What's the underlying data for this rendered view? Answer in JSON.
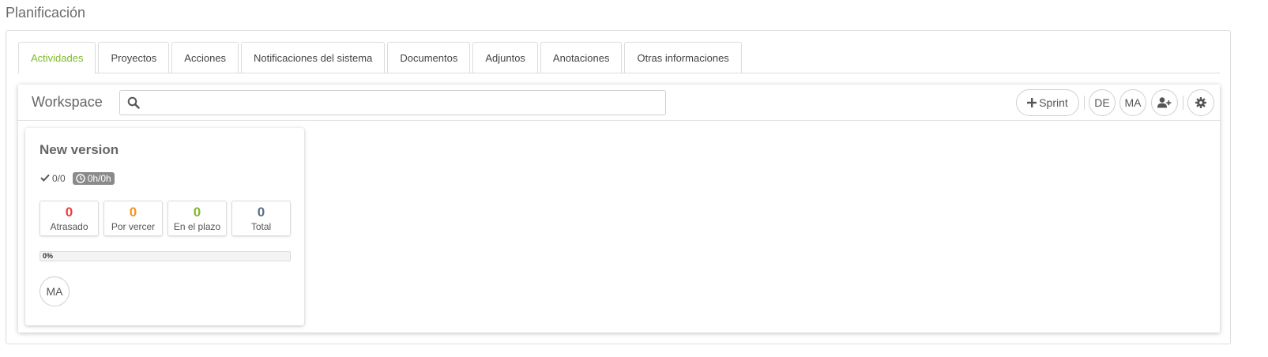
{
  "page_title": "Planificación",
  "tabs": [
    {
      "label": "Actividades",
      "active": true
    },
    {
      "label": "Proyectos"
    },
    {
      "label": "Acciones"
    },
    {
      "label": "Notificaciones del sistema"
    },
    {
      "label": "Documentos"
    },
    {
      "label": "Adjuntos"
    },
    {
      "label": "Anotaciones"
    },
    {
      "label": "Otras informaciones"
    }
  ],
  "workspace": {
    "title": "Workspace",
    "search": {
      "value": "",
      "placeholder": "",
      "icon": "search-icon"
    },
    "sprint_button": {
      "icon": "plus-icon",
      "label": "Sprint"
    },
    "user_filters": [
      "DE",
      "MA"
    ],
    "add_user_icon": "user-plus-icon",
    "settings_icon": "gear-icon"
  },
  "card": {
    "title": "New version",
    "tasks": "0/0",
    "hours": "0h/0h",
    "stats": [
      {
        "value": "0",
        "label": "Atrasado",
        "color": "#e8413d"
      },
      {
        "value": "0",
        "label": "Por vercer",
        "color": "#f7941d"
      },
      {
        "value": "0",
        "label": "En el plazo",
        "color": "#82b92e"
      },
      {
        "value": "0",
        "label": "Total",
        "color": "#5c6f86"
      }
    ],
    "progress": {
      "label": "0%",
      "value": 0
    },
    "avatar": "MA"
  },
  "colors": {
    "accent": "#82b92e"
  }
}
